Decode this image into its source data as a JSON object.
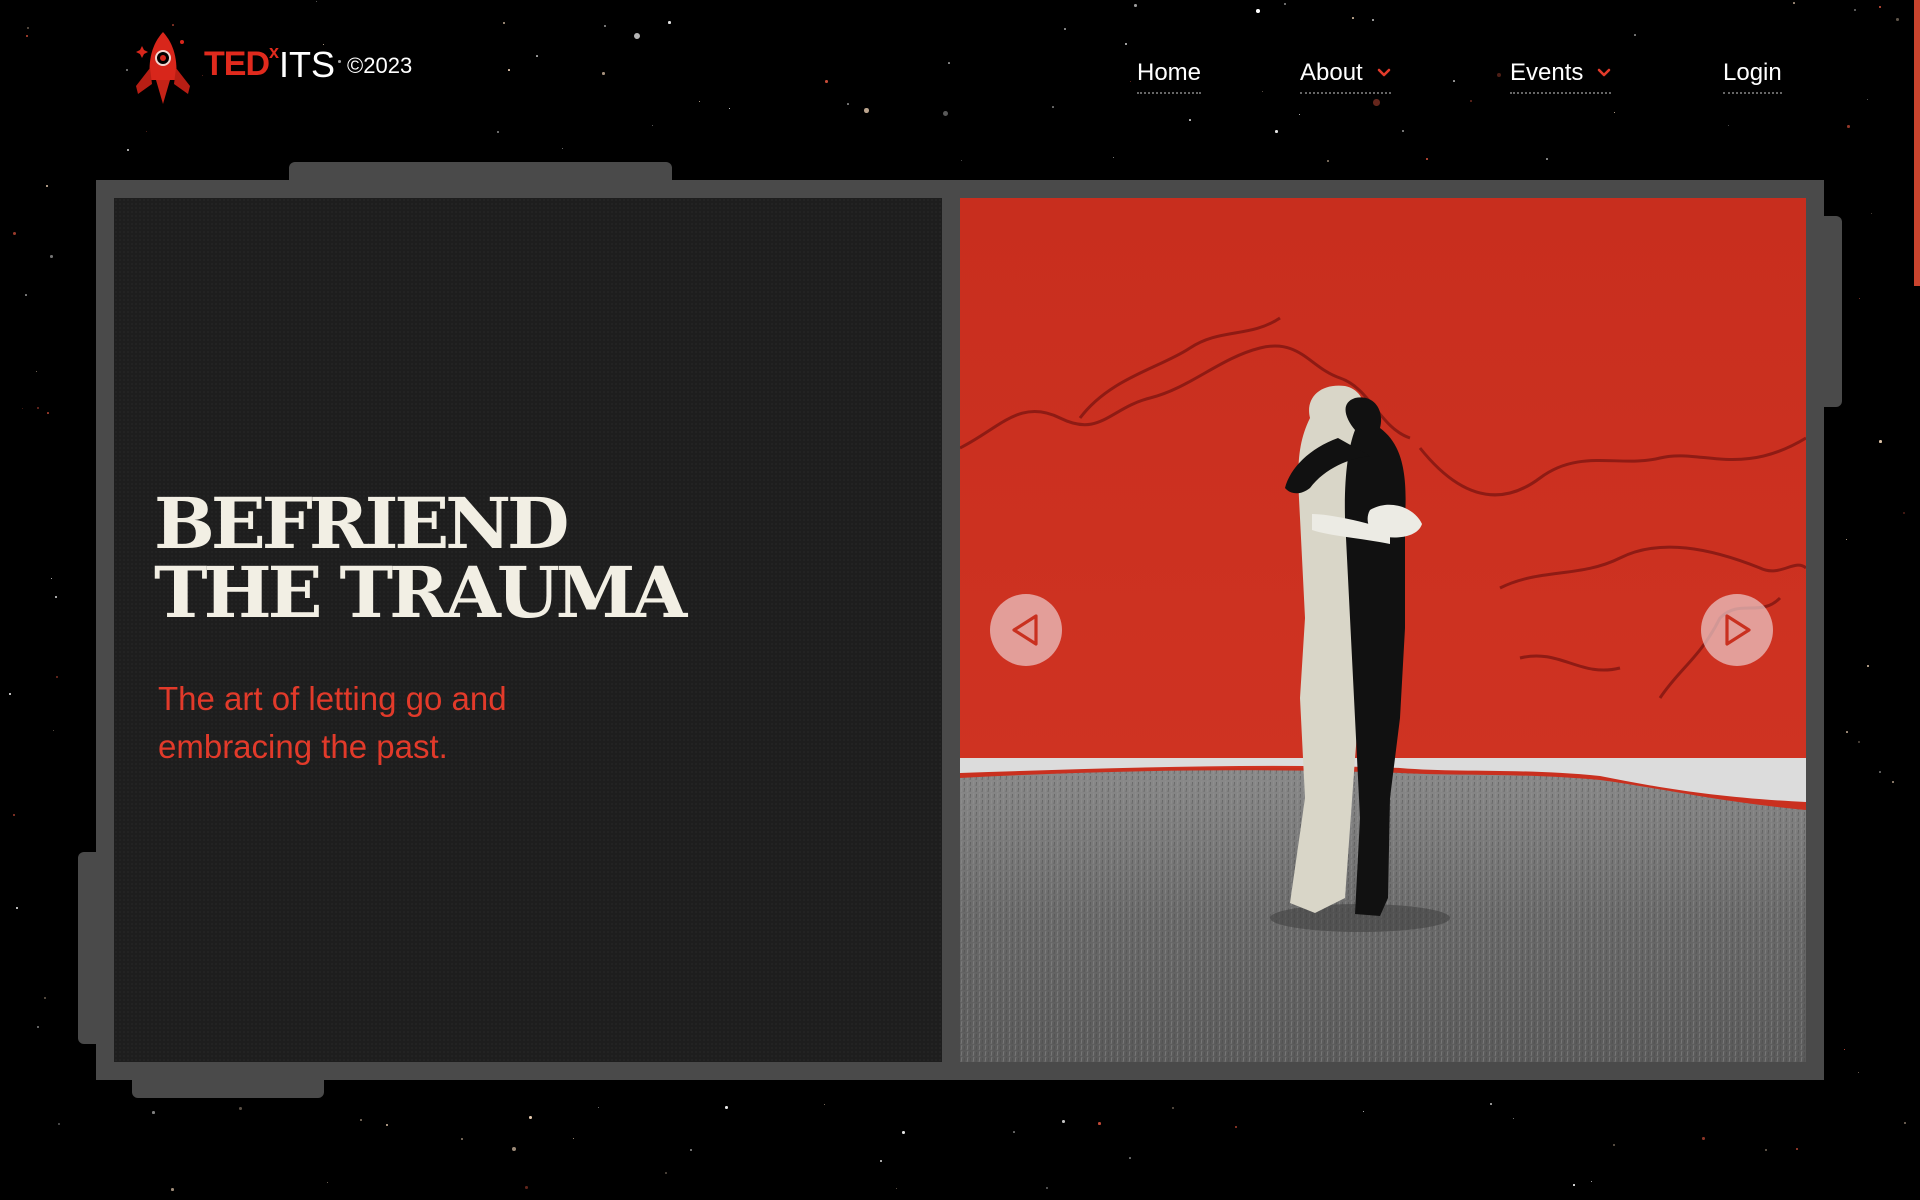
{
  "header": {
    "brand": {
      "ted": "TED",
      "x": "x",
      "its": "ITS",
      "year": "©2023",
      "logo_icon": "rocket-icon"
    },
    "nav": {
      "home": "Home",
      "about": "About",
      "events": "Events",
      "login": "Login",
      "dropdown_icon": "chevron-down-icon"
    }
  },
  "hero": {
    "headline_line1": "BEFRIEND",
    "headline_line2": "THE TRAUMA",
    "subtitle": "The art of letting go and embracing the past.",
    "carousel": {
      "prev_icon": "triangle-left-icon",
      "next_icon": "triangle-right-icon",
      "image_subject": "two figures embracing on grass against red wall"
    }
  },
  "colors": {
    "background": "#000000",
    "frame": "#4a4a4a",
    "panel": "#1e1e1e",
    "accent_red": "#e02a1d",
    "headline": "#f2efe4",
    "subtitle": "#e23a2a"
  }
}
